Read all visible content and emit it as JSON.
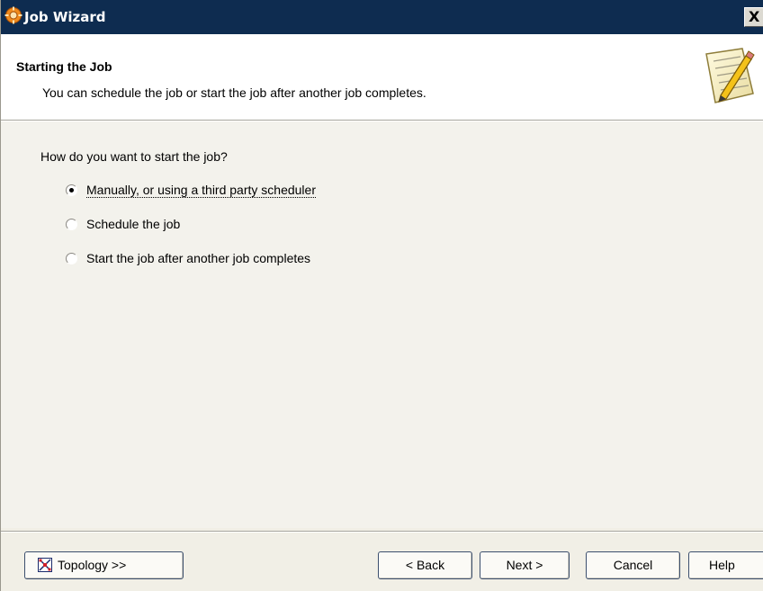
{
  "window": {
    "title": "Job Wizard",
    "title_icon": "app-gear-icon",
    "close_label": "X"
  },
  "header": {
    "title": "Starting the Job",
    "subtitle": "You can schedule the job or start the job after another job completes.",
    "icon": "notepad-pencil-icon"
  },
  "main": {
    "question": "How do you want to start the job?",
    "options": [
      {
        "label": "Manually, or using a third party scheduler",
        "selected": true
      },
      {
        "label": "Schedule the job",
        "selected": false
      },
      {
        "label": "Start the job after another job completes",
        "selected": false
      }
    ]
  },
  "footer": {
    "topology_label": "Topology >>",
    "topology_icon": "topology-icon",
    "back_label": "< Back",
    "next_label": "Next >",
    "cancel_label": "Cancel",
    "help_label": "Help"
  },
  "colors": {
    "titlebar": "#0e2c50",
    "dialog_background": "#f1efe6",
    "header_background": "#ffffff"
  }
}
